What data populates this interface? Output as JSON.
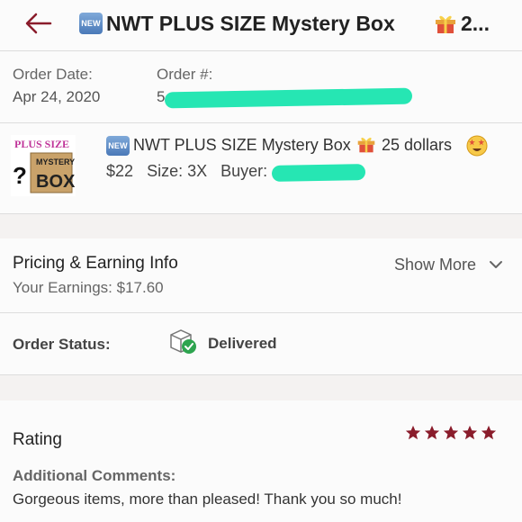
{
  "header": {
    "badge": "NEW",
    "title": "NWT PLUS SIZE Mystery Box",
    "title_suffix": "2..."
  },
  "order": {
    "date_label": "Order Date:",
    "date_value": "Apr 24, 2020",
    "number_label": "Order #:",
    "number_value_visible": "5"
  },
  "item": {
    "thumb_line1": "PLUS SIZE",
    "thumb_line2": "MYSTERY",
    "thumb_line3": "BOX",
    "thumb_q": "?",
    "badge": "NEW",
    "title": "NWT PLUS SIZE Mystery Box",
    "title_suffix": "25 dollars",
    "price": "$22",
    "size": "Size: 3X",
    "buyer_label": "Buyer:"
  },
  "pricing": {
    "title": "Pricing & Earning Info",
    "earnings": "Your Earnings: $17.60",
    "show_more": "Show More"
  },
  "status": {
    "label": "Order Status:",
    "value": "Delivered"
  },
  "rating": {
    "title": "Rating",
    "stars": 5,
    "comments_label": "Additional Comments:",
    "comments": "Gorgeous items, more than pleased! Thank you so much!"
  },
  "colors": {
    "accent": "#8a1c2b",
    "redaction": "#26e6b3",
    "delivered_check": "#2ea44f"
  }
}
